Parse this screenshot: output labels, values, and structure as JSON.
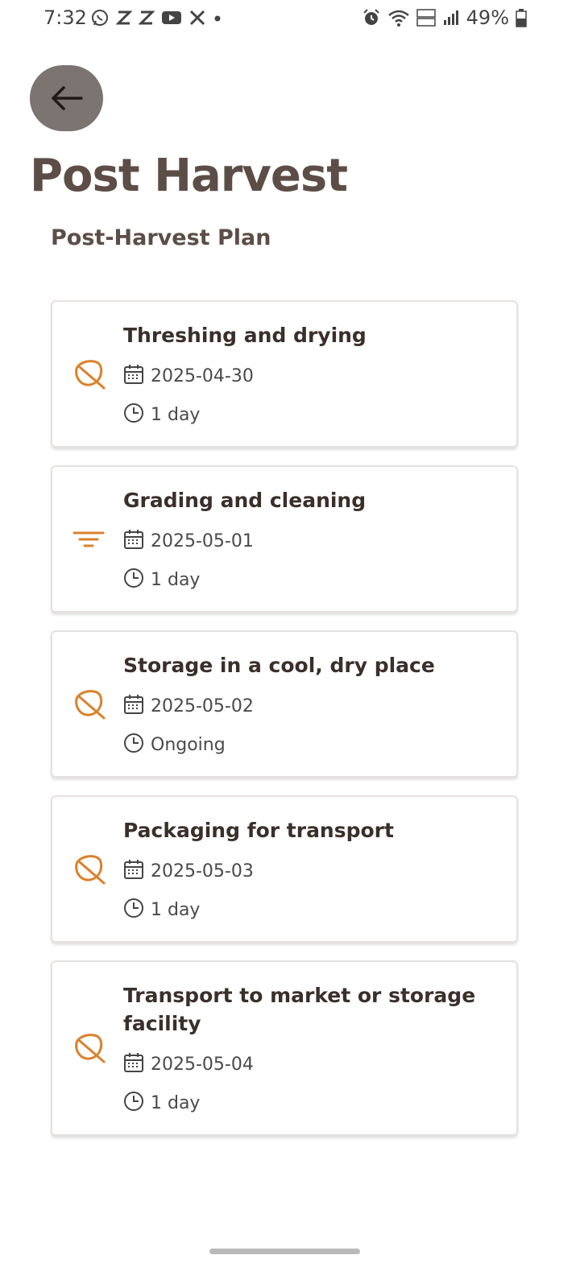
{
  "status_bar": {
    "time": "7:32",
    "battery": "49%",
    "left_icons": [
      "whatsapp-icon",
      "z-icon",
      "z-icon",
      "youtube-icon",
      "x-icon",
      "dot-icon"
    ],
    "right_icons": [
      "alarm-icon",
      "wifi-icon",
      "volte-icon",
      "signal-icon",
      "battery-icon"
    ]
  },
  "header": {
    "back_icon": "arrow-left-icon",
    "title": "Post Harvest",
    "subtitle": "Post-Harvest Plan"
  },
  "tasks": [
    {
      "title": "Threshing and drying",
      "date": "2025-04-30",
      "duration": "1 day",
      "icon": "leaf-icon"
    },
    {
      "title": "Grading and cleaning",
      "date": "2025-05-01",
      "duration": "1 day",
      "icon": "filter-icon"
    },
    {
      "title": "Storage in a cool, dry place",
      "date": "2025-05-02",
      "duration": "Ongoing",
      "icon": "leaf-icon"
    },
    {
      "title": "Packaging for transport",
      "date": "2025-05-03",
      "duration": "1 day",
      "icon": "leaf-icon"
    },
    {
      "title": "Transport to market or storage facility",
      "date": "2025-05-04",
      "duration": "1 day",
      "icon": "leaf-icon"
    }
  ],
  "colors": {
    "accent": "#d9822b",
    "title": "#5c4e47",
    "back_button": "#7b7470"
  }
}
